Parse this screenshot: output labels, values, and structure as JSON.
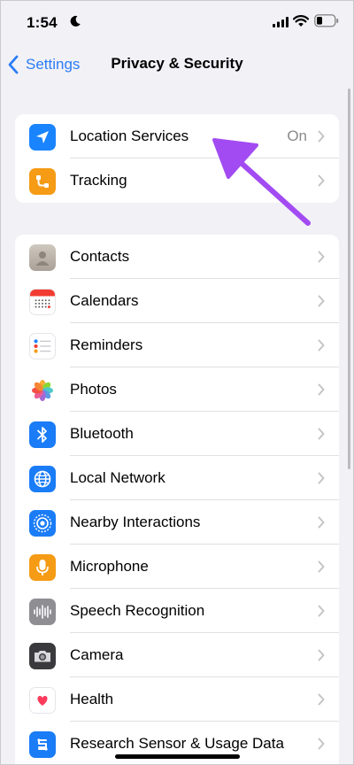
{
  "status": {
    "time": "1:54",
    "icons": [
      "moon-icon",
      "cellular-signal-icon",
      "wifi-icon",
      "battery-icon"
    ]
  },
  "nav": {
    "back_label": "Settings",
    "title": "Privacy & Security"
  },
  "groups": [
    {
      "items": [
        {
          "label": "Location Services",
          "value": "On",
          "icon": "location-arrow-icon",
          "color": "#1a84ff"
        },
        {
          "label": "Tracking",
          "value": "",
          "icon": "tracking-icon",
          "color": "#f59b15"
        }
      ]
    },
    {
      "items": [
        {
          "label": "Contacts",
          "icon": "contacts-icon",
          "color": "#b8b0a7"
        },
        {
          "label": "Calendars",
          "icon": "calendar-icon",
          "color": "#ffffff"
        },
        {
          "label": "Reminders",
          "icon": "reminders-icon",
          "color": "#ffffff"
        },
        {
          "label": "Photos",
          "icon": "photos-icon",
          "color": "#ffffff"
        },
        {
          "label": "Bluetooth",
          "icon": "bluetooth-icon",
          "color": "#1a7cf6"
        },
        {
          "label": "Local Network",
          "icon": "globe-icon",
          "color": "#1a7cf6"
        },
        {
          "label": "Nearby Interactions",
          "icon": "nearby-interactions-icon",
          "color": "#1a7cf6"
        },
        {
          "label": "Microphone",
          "icon": "microphone-icon",
          "color": "#f59b15"
        },
        {
          "label": "Speech Recognition",
          "icon": "waveform-icon",
          "color": "#8e8e93"
        },
        {
          "label": "Camera",
          "icon": "camera-icon",
          "color": "#3a3a3c"
        },
        {
          "label": "Health",
          "icon": "health-heart-icon",
          "color": "#ffffff"
        },
        {
          "label": "Research Sensor & Usage Data",
          "icon": "research-icon",
          "color": "#1a7cf6"
        }
      ]
    }
  ],
  "colors": {
    "accent": "#2b7cf6",
    "annotation": "#a24bf2",
    "background": "#f2f1f6"
  }
}
